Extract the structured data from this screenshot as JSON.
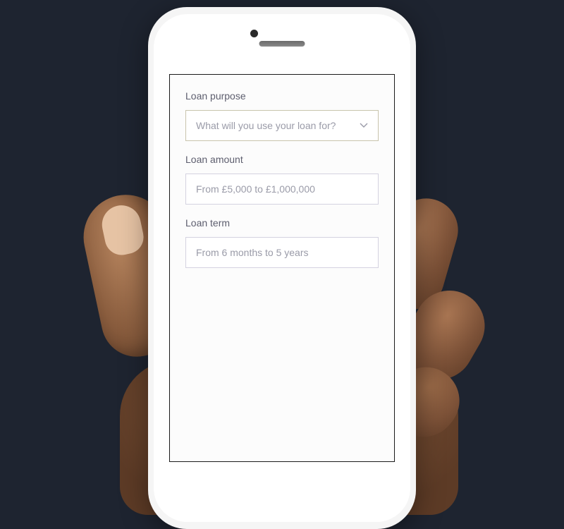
{
  "form": {
    "purpose": {
      "label": "Loan purpose",
      "placeholder": "What will you use your loan for?"
    },
    "amount": {
      "label": "Loan amount",
      "placeholder": "From £5,000 to £1,000,000"
    },
    "term": {
      "label": "Loan term",
      "placeholder": "From 6 months to 5 years"
    }
  }
}
